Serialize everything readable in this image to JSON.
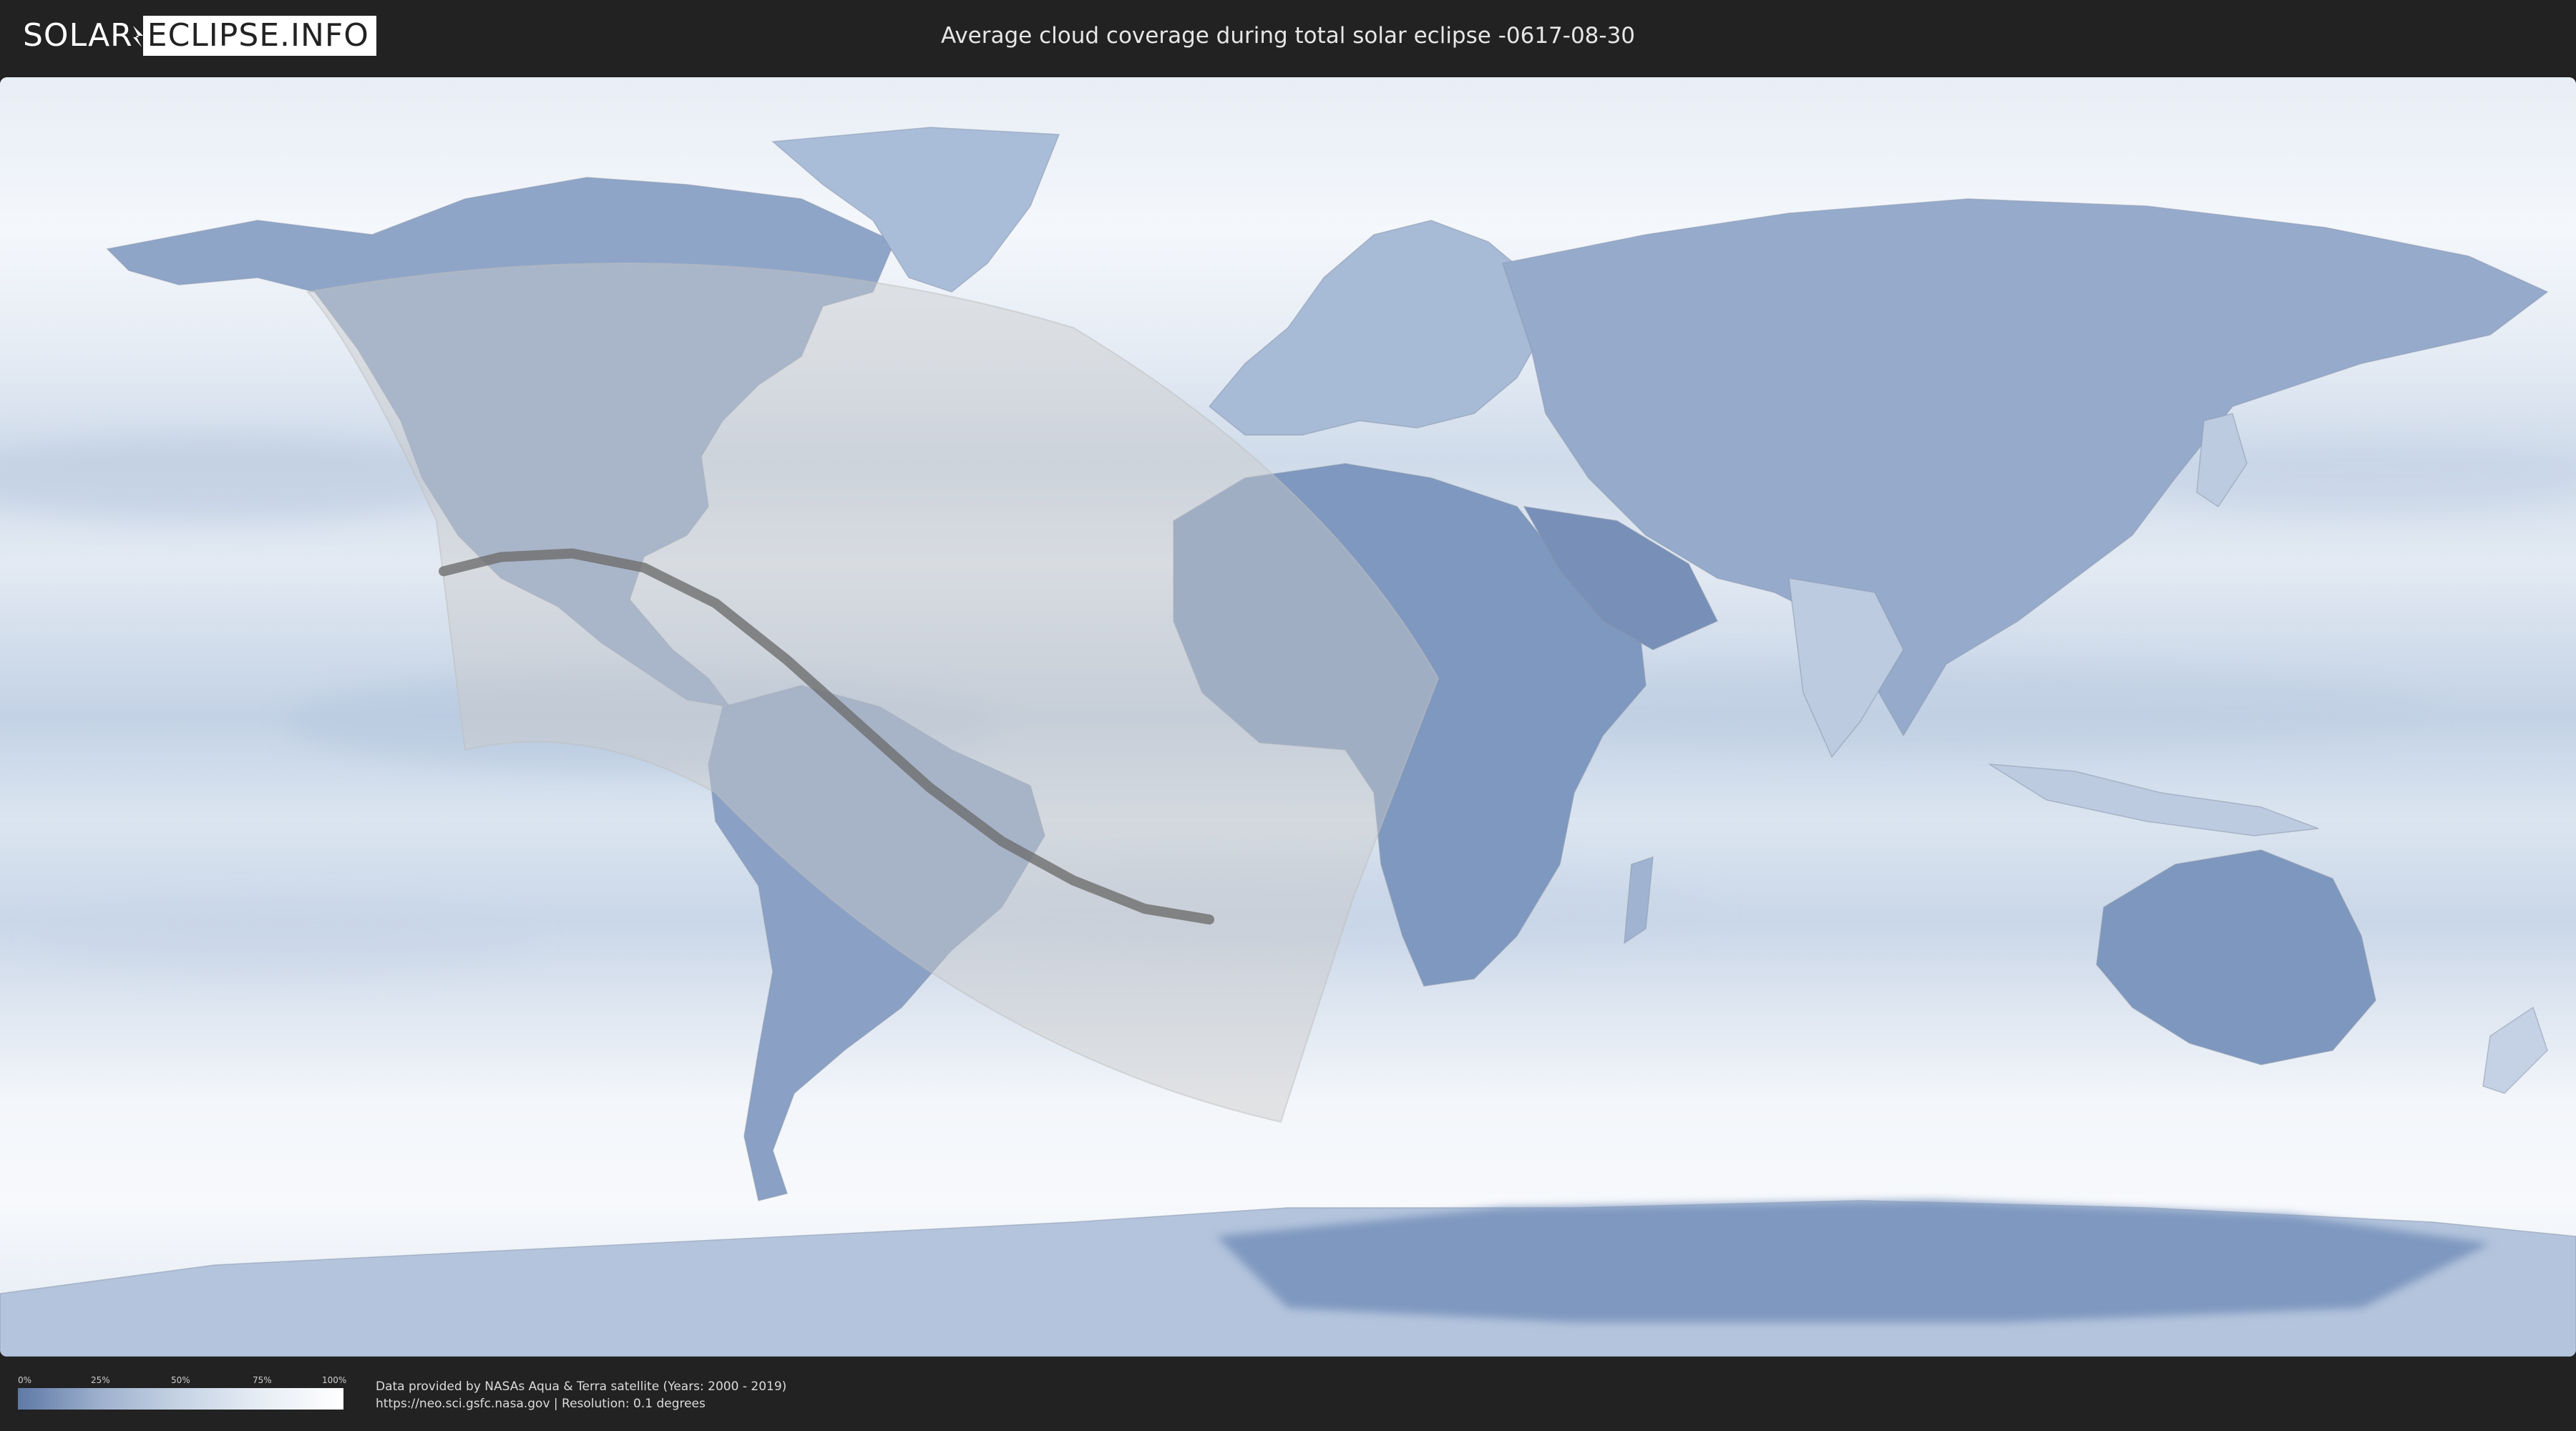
{
  "logo": {
    "left": "SOLAR",
    "right": "ECLIPSE.INFO"
  },
  "title": "Average cloud coverage during total solar eclipse -0617-08-30",
  "legend": {
    "ticks": [
      "0%",
      "25%",
      "50%",
      "75%",
      "100%"
    ],
    "colors": {
      "low": "#5f79a6",
      "high": "#ffffff"
    }
  },
  "credits": {
    "line1": "Data provided by NASAs Aqua & Terra satellite (Years: 2000 - 2019)",
    "line2": "https://neo.sci.gsfc.nasa.gov | Resolution: 0.1 degrees"
  },
  "map": {
    "projection": "equirectangular",
    "colors": {
      "clear": "#5f79a6",
      "cloud": "#f4f7fb",
      "overlay": "#c9c9c9",
      "path": "#6e6e6e"
    },
    "eclipse_path_lonlat": [
      [
        -118,
        20.5
      ],
      [
        -110,
        22.5
      ],
      [
        -100,
        23
      ],
      [
        -90,
        21
      ],
      [
        -80,
        16
      ],
      [
        -70,
        8
      ],
      [
        -60,
        -1
      ],
      [
        -50,
        -10
      ],
      [
        -40,
        -17.5
      ],
      [
        -30,
        -23
      ],
      [
        -20,
        -27
      ],
      [
        -11,
        -28.5
      ]
    ]
  }
}
